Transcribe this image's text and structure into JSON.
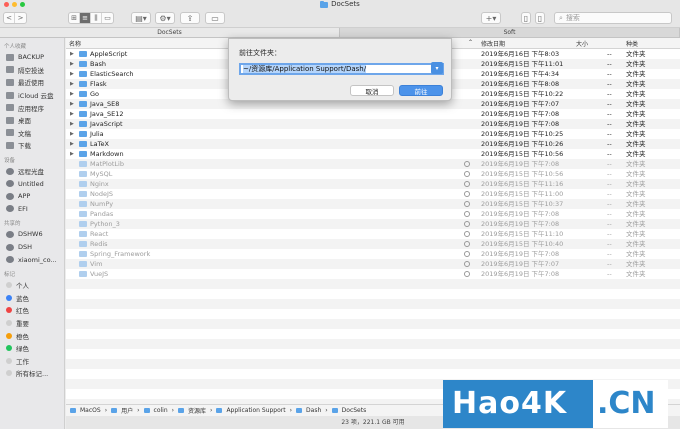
{
  "window": {
    "title": "DocSets"
  },
  "toolbar": {
    "search_placeholder": "搜索",
    "add_label": "+",
    "nav_back": "<",
    "nav_forward": ">"
  },
  "tabs": [
    {
      "label": "DocSets"
    },
    {
      "label": "Soft"
    }
  ],
  "sidebar": {
    "sections": [
      {
        "title": "个人收藏",
        "items": [
          "BACKUP",
          "隔空投送",
          "最近使用",
          "iCloud 云盘",
          "应用程序",
          "桌面",
          "文稿",
          "下载"
        ]
      },
      {
        "title": "设备",
        "items": [
          "远程光盘",
          "Untitled",
          "APP",
          "EFI"
        ]
      },
      {
        "title": "共享的",
        "items": [
          "DSHW6",
          "DSH",
          "xiaomi_co..."
        ]
      },
      {
        "title": "标记",
        "items": [
          "个人",
          "蓝色",
          "红色",
          "重要",
          "橙色",
          "绿色",
          "工作",
          "所有标记..."
        ]
      }
    ],
    "tag_colors": [
      "#cfcfcf",
      "#3b82f6",
      "#ef4444",
      "#cfcfcf",
      "#f59e0b",
      "#22c55e",
      "#cfcfcf",
      "#cfcfcf"
    ]
  },
  "columns": {
    "name": "名称",
    "date": "修改日期",
    "size": "大小",
    "kind": "种类"
  },
  "files": [
    {
      "name": "AppleScript",
      "date": "2019年6月16日 下午8:03",
      "size": "--",
      "kind": "文件夹",
      "dim": false
    },
    {
      "name": "Bash",
      "date": "2019年6月15日 下午11:01",
      "size": "--",
      "kind": "文件夹",
      "dim": false
    },
    {
      "name": "ElasticSearch",
      "date": "2019年6月16日 下午4:34",
      "size": "--",
      "kind": "文件夹",
      "dim": false
    },
    {
      "name": "Flask",
      "date": "2019年6月16日 下午8:08",
      "size": "--",
      "kind": "文件夹",
      "dim": false
    },
    {
      "name": "Go",
      "date": "2019年6月15日 下午10:22",
      "size": "--",
      "kind": "文件夹",
      "dim": false
    },
    {
      "name": "Java_SE8",
      "date": "2019年6月19日 下午7:07",
      "size": "--",
      "kind": "文件夹",
      "dim": false
    },
    {
      "name": "Java_SE12",
      "date": "2019年6月19日 下午7:08",
      "size": "--",
      "kind": "文件夹",
      "dim": false
    },
    {
      "name": "JavaScript",
      "date": "2019年6月19日 下午7:08",
      "size": "--",
      "kind": "文件夹",
      "dim": false
    },
    {
      "name": "Julia",
      "date": "2019年6月19日 下午10:25",
      "size": "--",
      "kind": "文件夹",
      "dim": false
    },
    {
      "name": "LaTeX",
      "date": "2019年6月19日 下午10:26",
      "size": "--",
      "kind": "文件夹",
      "dim": false
    },
    {
      "name": "Markdown",
      "date": "2019年6月15日 下午10:56",
      "size": "--",
      "kind": "文件夹",
      "dim": false
    },
    {
      "name": "MatPlotLib",
      "date": "2019年6月19日 下午7:08",
      "size": "--",
      "kind": "文件夹",
      "dim": true
    },
    {
      "name": "MySQL",
      "date": "2019年6月15日 下午10:56",
      "size": "--",
      "kind": "文件夹",
      "dim": true
    },
    {
      "name": "Nginx",
      "date": "2019年6月15日 下午11:16",
      "size": "--",
      "kind": "文件夹",
      "dim": true
    },
    {
      "name": "NodeJS",
      "date": "2019年6月15日 下午11:00",
      "size": "--",
      "kind": "文件夹",
      "dim": true
    },
    {
      "name": "NumPy",
      "date": "2019年6月15日 下午10:37",
      "size": "--",
      "kind": "文件夹",
      "dim": true
    },
    {
      "name": "Pandas",
      "date": "2019年6月19日 下午7:08",
      "size": "--",
      "kind": "文件夹",
      "dim": true
    },
    {
      "name": "Python_3",
      "date": "2019年6月19日 下午7:08",
      "size": "--",
      "kind": "文件夹",
      "dim": true
    },
    {
      "name": "React",
      "date": "2019年6月15日 下午11:10",
      "size": "--",
      "kind": "文件夹",
      "dim": true
    },
    {
      "name": "Redis",
      "date": "2019年6月15日 下午10:40",
      "size": "--",
      "kind": "文件夹",
      "dim": true
    },
    {
      "name": "Spring_Framework",
      "date": "2019年6月19日 下午7:08",
      "size": "--",
      "kind": "文件夹",
      "dim": true
    },
    {
      "name": "Vim",
      "date": "2019年6月19日 下午7:07",
      "size": "--",
      "kind": "文件夹",
      "dim": true
    },
    {
      "name": "VueJS",
      "date": "2019年6月19日 下午7:08",
      "size": "--",
      "kind": "文件夹",
      "dim": true
    }
  ],
  "path": [
    "MacOS",
    "用户",
    "colin",
    "资源库",
    "Application Support",
    "Dash",
    "DocSets"
  ],
  "status": "23 项，221.1 GB 可用",
  "dialog": {
    "label": "前往文件夹：",
    "value": "~/资源库/Application Support/Dash/",
    "cancel": "取消",
    "go": "前往"
  },
  "watermark": {
    "left": "Hao4K",
    "right": ".CN"
  }
}
